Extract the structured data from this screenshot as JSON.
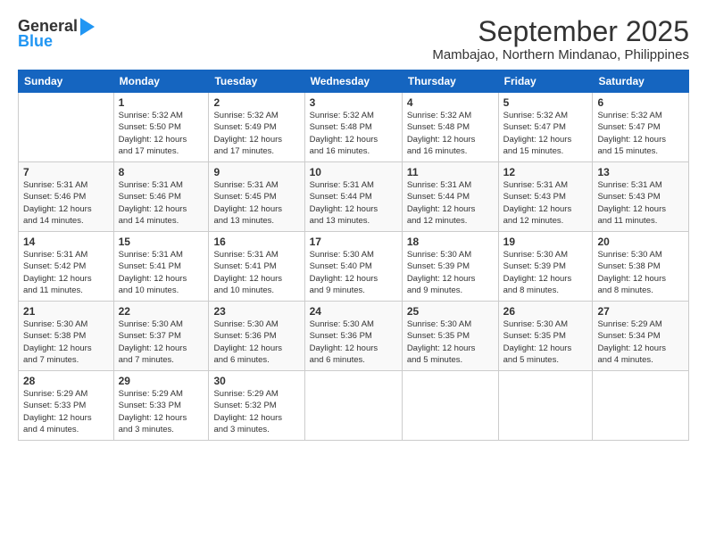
{
  "logo": {
    "general": "General",
    "blue": "Blue"
  },
  "title": {
    "month": "September 2025",
    "location": "Mambajao, Northern Mindanao, Philippines"
  },
  "headers": [
    "Sunday",
    "Monday",
    "Tuesday",
    "Wednesday",
    "Thursday",
    "Friday",
    "Saturday"
  ],
  "weeks": [
    [
      {
        "day": "",
        "info": ""
      },
      {
        "day": "1",
        "info": "Sunrise: 5:32 AM\nSunset: 5:50 PM\nDaylight: 12 hours\nand 17 minutes."
      },
      {
        "day": "2",
        "info": "Sunrise: 5:32 AM\nSunset: 5:49 PM\nDaylight: 12 hours\nand 17 minutes."
      },
      {
        "day": "3",
        "info": "Sunrise: 5:32 AM\nSunset: 5:48 PM\nDaylight: 12 hours\nand 16 minutes."
      },
      {
        "day": "4",
        "info": "Sunrise: 5:32 AM\nSunset: 5:48 PM\nDaylight: 12 hours\nand 16 minutes."
      },
      {
        "day": "5",
        "info": "Sunrise: 5:32 AM\nSunset: 5:47 PM\nDaylight: 12 hours\nand 15 minutes."
      },
      {
        "day": "6",
        "info": "Sunrise: 5:32 AM\nSunset: 5:47 PM\nDaylight: 12 hours\nand 15 minutes."
      }
    ],
    [
      {
        "day": "7",
        "info": "Sunrise: 5:31 AM\nSunset: 5:46 PM\nDaylight: 12 hours\nand 14 minutes."
      },
      {
        "day": "8",
        "info": "Sunrise: 5:31 AM\nSunset: 5:46 PM\nDaylight: 12 hours\nand 14 minutes."
      },
      {
        "day": "9",
        "info": "Sunrise: 5:31 AM\nSunset: 5:45 PM\nDaylight: 12 hours\nand 13 minutes."
      },
      {
        "day": "10",
        "info": "Sunrise: 5:31 AM\nSunset: 5:44 PM\nDaylight: 12 hours\nand 13 minutes."
      },
      {
        "day": "11",
        "info": "Sunrise: 5:31 AM\nSunset: 5:44 PM\nDaylight: 12 hours\nand 12 minutes."
      },
      {
        "day": "12",
        "info": "Sunrise: 5:31 AM\nSunset: 5:43 PM\nDaylight: 12 hours\nand 12 minutes."
      },
      {
        "day": "13",
        "info": "Sunrise: 5:31 AM\nSunset: 5:43 PM\nDaylight: 12 hours\nand 11 minutes."
      }
    ],
    [
      {
        "day": "14",
        "info": "Sunrise: 5:31 AM\nSunset: 5:42 PM\nDaylight: 12 hours\nand 11 minutes."
      },
      {
        "day": "15",
        "info": "Sunrise: 5:31 AM\nSunset: 5:41 PM\nDaylight: 12 hours\nand 10 minutes."
      },
      {
        "day": "16",
        "info": "Sunrise: 5:31 AM\nSunset: 5:41 PM\nDaylight: 12 hours\nand 10 minutes."
      },
      {
        "day": "17",
        "info": "Sunrise: 5:30 AM\nSunset: 5:40 PM\nDaylight: 12 hours\nand 9 minutes."
      },
      {
        "day": "18",
        "info": "Sunrise: 5:30 AM\nSunset: 5:39 PM\nDaylight: 12 hours\nand 9 minutes."
      },
      {
        "day": "19",
        "info": "Sunrise: 5:30 AM\nSunset: 5:39 PM\nDaylight: 12 hours\nand 8 minutes."
      },
      {
        "day": "20",
        "info": "Sunrise: 5:30 AM\nSunset: 5:38 PM\nDaylight: 12 hours\nand 8 minutes."
      }
    ],
    [
      {
        "day": "21",
        "info": "Sunrise: 5:30 AM\nSunset: 5:38 PM\nDaylight: 12 hours\nand 7 minutes."
      },
      {
        "day": "22",
        "info": "Sunrise: 5:30 AM\nSunset: 5:37 PM\nDaylight: 12 hours\nand 7 minutes."
      },
      {
        "day": "23",
        "info": "Sunrise: 5:30 AM\nSunset: 5:36 PM\nDaylight: 12 hours\nand 6 minutes."
      },
      {
        "day": "24",
        "info": "Sunrise: 5:30 AM\nSunset: 5:36 PM\nDaylight: 12 hours\nand 6 minutes."
      },
      {
        "day": "25",
        "info": "Sunrise: 5:30 AM\nSunset: 5:35 PM\nDaylight: 12 hours\nand 5 minutes."
      },
      {
        "day": "26",
        "info": "Sunrise: 5:30 AM\nSunset: 5:35 PM\nDaylight: 12 hours\nand 5 minutes."
      },
      {
        "day": "27",
        "info": "Sunrise: 5:29 AM\nSunset: 5:34 PM\nDaylight: 12 hours\nand 4 minutes."
      }
    ],
    [
      {
        "day": "28",
        "info": "Sunrise: 5:29 AM\nSunset: 5:33 PM\nDaylight: 12 hours\nand 4 minutes."
      },
      {
        "day": "29",
        "info": "Sunrise: 5:29 AM\nSunset: 5:33 PM\nDaylight: 12 hours\nand 3 minutes."
      },
      {
        "day": "30",
        "info": "Sunrise: 5:29 AM\nSunset: 5:32 PM\nDaylight: 12 hours\nand 3 minutes."
      },
      {
        "day": "",
        "info": ""
      },
      {
        "day": "",
        "info": ""
      },
      {
        "day": "",
        "info": ""
      },
      {
        "day": "",
        "info": ""
      }
    ]
  ]
}
